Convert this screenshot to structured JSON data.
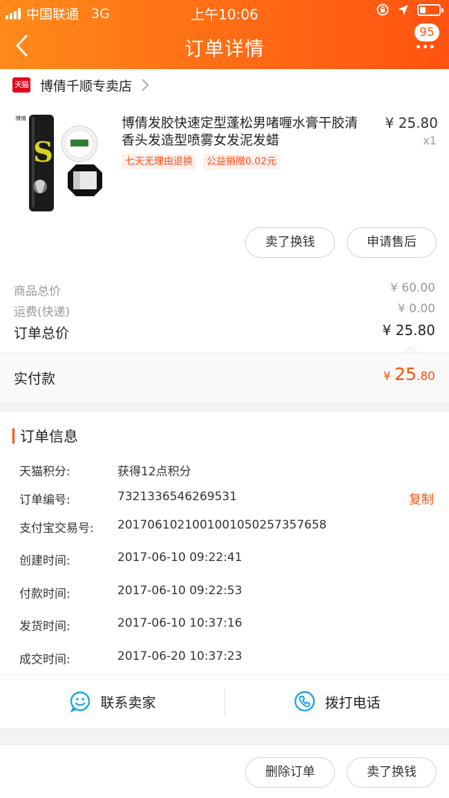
{
  "status_bar": {
    "carrier": "中国联通",
    "network": "3G",
    "time": "上午10:06",
    "battery_level": 0.3
  },
  "nav": {
    "title": "订单详情",
    "badge": "95",
    "icons": [
      "back-arrow-icon",
      "more-dots-icon"
    ]
  },
  "shop": {
    "tag": "天猫",
    "name": "博倩千顺专卖店"
  },
  "product": {
    "title": "博倩发胶快速定型蓬松男啫喱水膏干胶清香头发造型喷雾女发泥发蜡",
    "price": "¥ 25.80",
    "qty": "x1",
    "tags": [
      "七天无理由退换",
      "公益捐赠0.02元"
    ],
    "image_text": "S",
    "buttons": {
      "sell": "卖了换钱",
      "after_sale": "申请售后"
    }
  },
  "summary": {
    "goods_total_label": "商品总价",
    "goods_total": "¥ 60.00",
    "shipping_label": "运费(快递)",
    "shipping": "¥ 0.00",
    "order_total_label": "订单总价",
    "order_total": "¥ 25.80",
    "paid_label": "实付款",
    "paid_currency": "¥ ",
    "paid_int": "25",
    "paid_dec": ".80"
  },
  "order_info": {
    "title": "订单信息",
    "rows": [
      {
        "k": "天猫积分:",
        "v": "获得12点积分"
      },
      {
        "k": "订单编号:",
        "v": "7321336546269531",
        "action": "复制"
      },
      {
        "k": "支付宝交易号:",
        "v": "2017061021001001050257357658"
      },
      {
        "k": "创建时间:",
        "v": "2017-06-10 09:22:41"
      },
      {
        "k": "付款时间:",
        "v": "2017-06-10 09:22:53"
      },
      {
        "k": "发货时间:",
        "v": "2017-06-10 10:37:16"
      },
      {
        "k": "成交时间:",
        "v": "2017-06-20 10:37:23"
      }
    ],
    "contact_seller": "联系卖家",
    "call_phone": "拨打电话"
  },
  "bottom_bar": {
    "delete": "删除订单",
    "sell": "卖了换钱"
  },
  "colors": {
    "accent": "#ff5000",
    "header_from": "#ff8a1a",
    "header_to": "#ff5310",
    "tmall_red": "#e3071b",
    "icon_blue": "#1aa3ea"
  }
}
